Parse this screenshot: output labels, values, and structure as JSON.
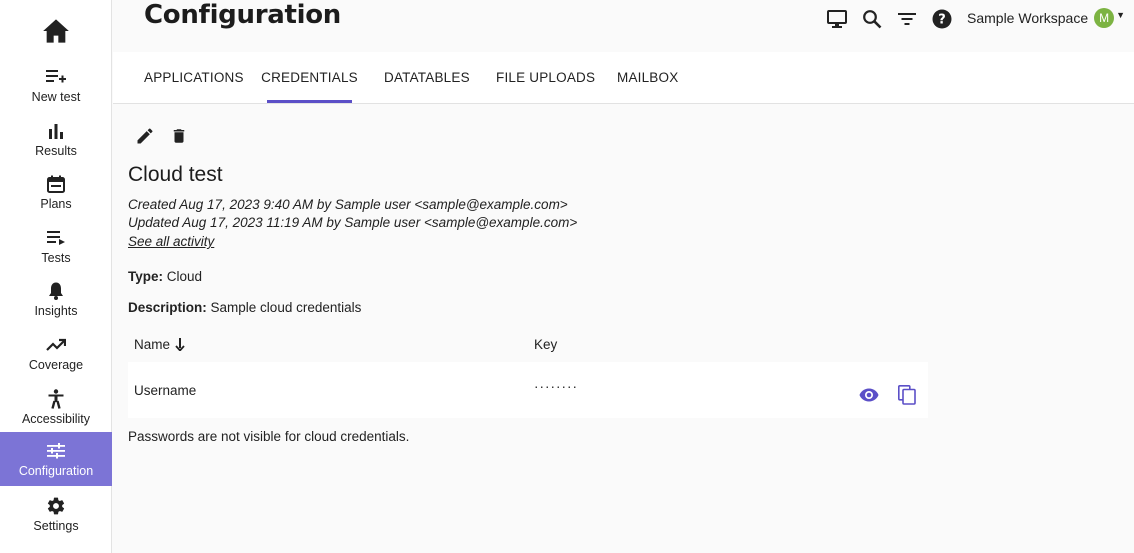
{
  "sidebar": {
    "home_icon": "home-icon",
    "items": [
      {
        "label": "New test",
        "icon": "new-test-icon"
      },
      {
        "label": "Results",
        "icon": "bar-chart-icon"
      },
      {
        "label": "Plans",
        "icon": "calendar-icon"
      },
      {
        "label": "Tests",
        "icon": "test-list-icon"
      },
      {
        "label": "Insights",
        "icon": "bell-icon"
      },
      {
        "label": "Coverage",
        "icon": "trending-up-icon"
      },
      {
        "label": "Accessibility",
        "icon": "accessibility-icon"
      },
      {
        "label": "Configuration",
        "icon": "sliders-icon",
        "active": true
      },
      {
        "label": "Settings",
        "icon": "gear-icon"
      }
    ]
  },
  "header": {
    "title": "Configuration",
    "icons": [
      "monitor-icon",
      "search-icon",
      "filter-icon",
      "help-icon"
    ],
    "workspace_name": "Sample Workspace",
    "avatar_initial": "M"
  },
  "tabs": [
    {
      "label": "APPLICATIONS"
    },
    {
      "label": "CREDENTIALS",
      "active": true
    },
    {
      "label": "DATATABLES"
    },
    {
      "label": "FILE UPLOADS"
    },
    {
      "label": "MAILBOX"
    }
  ],
  "credential": {
    "title": "Cloud test",
    "created": "Created Aug 17, 2023 9:40 AM by Sample user <sample@example.com>",
    "updated": "Updated Aug 17, 2023 11:19 AM by Sample user <sample@example.com>",
    "activity_link": "See all activity",
    "type_label": "Type:",
    "type_value": "Cloud",
    "description_label": "Description:",
    "description_value": "Sample cloud credentials"
  },
  "table": {
    "col_name": "Name",
    "col_key": "Key",
    "rows": [
      {
        "name": "Username",
        "key": "········"
      }
    ]
  },
  "note": "Passwords are not visible for cloud credentials.",
  "colors": {
    "accent": "#5b4fc7",
    "sidebar_active": "#7c74d6",
    "avatar": "#7cb342",
    "row_icon": "#5b4fc7"
  }
}
